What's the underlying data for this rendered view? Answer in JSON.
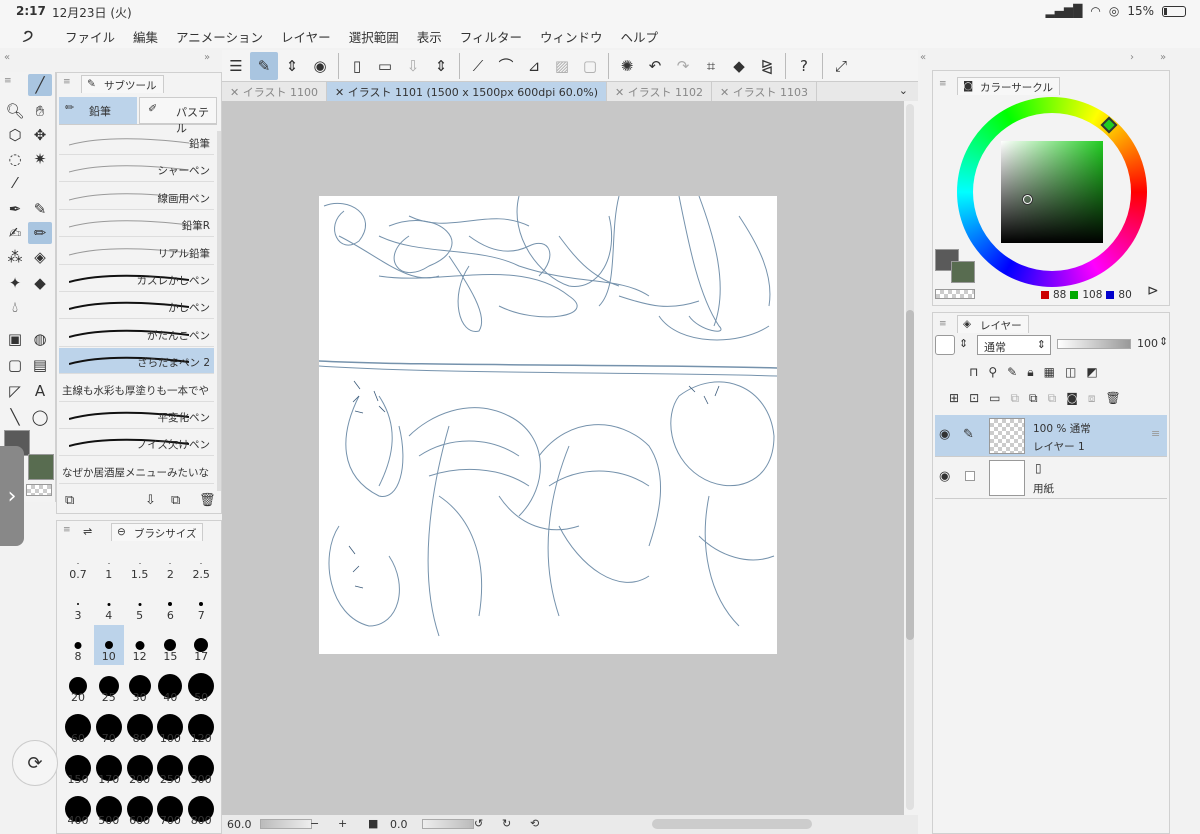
{
  "status": {
    "time": "2:17",
    "date": "12月23日 (火)",
    "battery": "15%"
  },
  "menu": [
    "ファイル",
    "編集",
    "アニメーション",
    "レイヤー",
    "選択範囲",
    "表示",
    "フィルター",
    "ウィンドウ",
    "ヘルプ"
  ],
  "tabs": [
    {
      "label": "イラスト 1100",
      "active": false
    },
    {
      "label": "イラスト 1101 (1500 x 1500px 600dpi 60.0%)",
      "active": true
    },
    {
      "label": "イラスト 1102",
      "active": false
    },
    {
      "label": "イラスト 1103",
      "active": false
    }
  ],
  "subtool": {
    "title": "サブツール",
    "tab_pencil": "鉛筆",
    "tab_pastel": "パステル",
    "items": [
      {
        "label": "鉛筆",
        "selected": false
      },
      {
        "label": "シャーペン",
        "selected": false
      },
      {
        "label": "線画用ペン",
        "selected": false
      },
      {
        "label": "鉛筆R",
        "selected": false
      },
      {
        "label": "リアル鉛筆",
        "selected": false
      },
      {
        "label": "カスレかしペン",
        "selected": false
      },
      {
        "label": "かしペン",
        "selected": false
      },
      {
        "label": "がたんこペン",
        "selected": false
      },
      {
        "label": "ざらだまペン 2",
        "selected": true
      },
      {
        "label": "主線も水彩も厚塗りも一本でや",
        "selected": false
      },
      {
        "label": "平変化ペン",
        "selected": false
      },
      {
        "label": "ノイズ欠けペン",
        "selected": false
      },
      {
        "label": "なぜか居酒屋メニューみたいな",
        "selected": false
      }
    ]
  },
  "brush": {
    "title": "ブラシサイズ",
    "sizes": [
      "0.7",
      "1",
      "1.5",
      "2",
      "2.5",
      "3",
      "4",
      "5",
      "6",
      "7",
      "8",
      "10",
      "12",
      "15",
      "17",
      "20",
      "25",
      "30",
      "40",
      "50",
      "60",
      "70",
      "80",
      "100",
      "120",
      "150",
      "170",
      "200",
      "250",
      "300",
      "400",
      "500",
      "600",
      "700",
      "800"
    ],
    "selected": "10"
  },
  "color": {
    "title": "カラーサークル",
    "r": "88",
    "g": "108",
    "b": "80",
    "main_color": "#5a5a5a",
    "sub_color": "#586c50",
    "hue_color": "#22cc22"
  },
  "layers": {
    "title": "レイヤー",
    "blend_mode": "通常",
    "opacity": "100",
    "items": [
      {
        "info": "100 % 通常",
        "name": "レイヤー 1",
        "selected": true
      },
      {
        "info": "",
        "name": "用紙",
        "selected": false
      }
    ]
  },
  "bottom": {
    "zoom": "60.0",
    "rotation": "0.0"
  }
}
